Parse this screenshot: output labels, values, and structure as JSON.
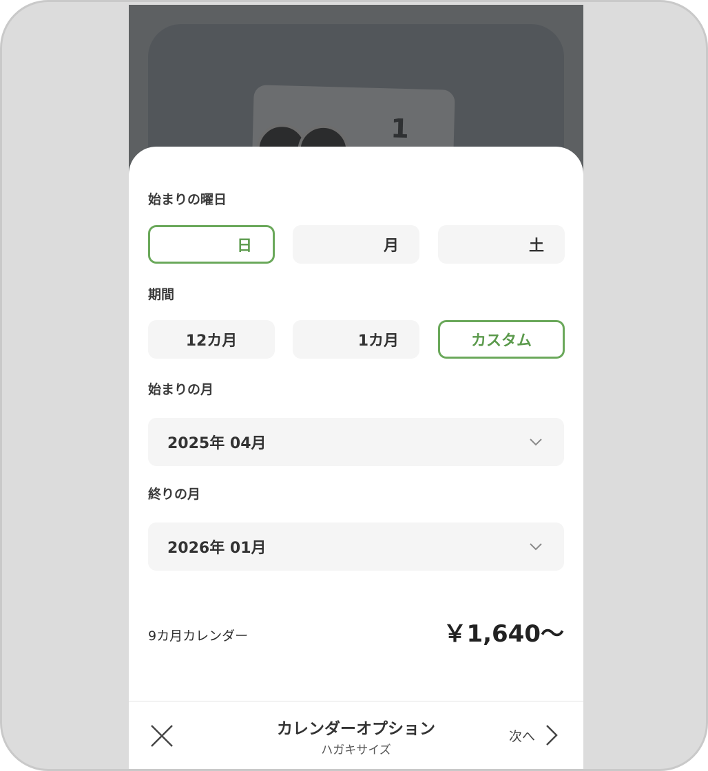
{
  "preview": {
    "photo_number": "1"
  },
  "sheet": {
    "weekday_section": {
      "label": "始まりの曜日",
      "options": [
        "日",
        "月",
        "土"
      ],
      "selected": "日"
    },
    "period_section": {
      "label": "期間",
      "options": [
        "12カ月",
        "1カ月",
        "カスタム"
      ],
      "selected": "カスタム"
    },
    "start_month": {
      "label": "始まりの月",
      "value": "2025年 04月"
    },
    "end_month": {
      "label": "終りの月",
      "value": "2026年 01月"
    },
    "summary": {
      "label": "9カ月カレンダー",
      "price": "￥1,640～"
    }
  },
  "bottom_bar": {
    "title": "カレンダーオプション",
    "subtitle": "ハガキサイズ",
    "next_label": "次へ"
  },
  "colors": {
    "accent_green": "#6aa85a",
    "chip_background": "#f5f5f5",
    "overlay_dark": "#5d6062"
  }
}
